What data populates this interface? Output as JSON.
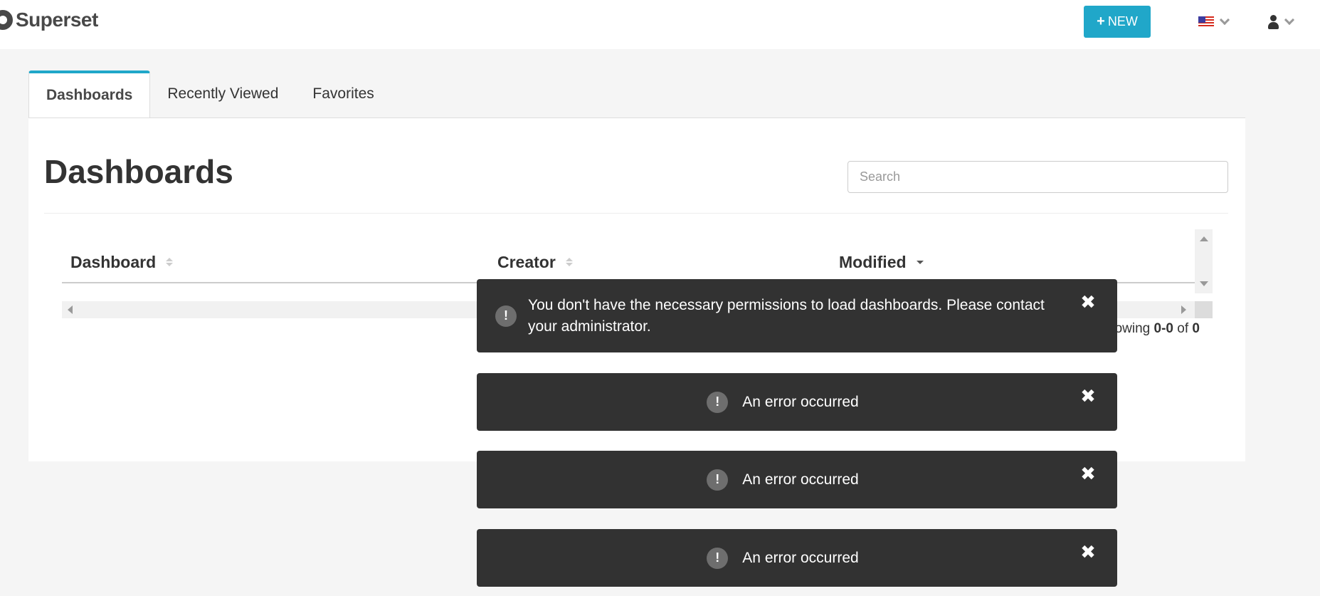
{
  "navbar": {
    "brand": "Superset",
    "new_button": "NEW",
    "new_icon": "+"
  },
  "tabs": [
    {
      "label": "Dashboards",
      "active": true
    },
    {
      "label": "Recently Viewed",
      "active": false
    },
    {
      "label": "Favorites",
      "active": false
    }
  ],
  "page": {
    "title": "Dashboards",
    "search_placeholder": "Search"
  },
  "table": {
    "columns": [
      "Dashboard",
      "Creator",
      "Modified"
    ],
    "rows": []
  },
  "pager": {
    "prefix": "Showing",
    "range": "0-0",
    "of": "of",
    "total": "0"
  },
  "toasts": [
    {
      "text": "You don't have the necessary permissions to load dashboards. Please contact your administrator.",
      "icon": "!",
      "close": "✖"
    },
    {
      "text": "An error occurred",
      "icon": "!",
      "close": "✖"
    },
    {
      "text": "An error occurred",
      "icon": "!",
      "close": "✖"
    },
    {
      "text": "An error occurred",
      "icon": "!",
      "close": "✖"
    }
  ],
  "colors": {
    "accent": "#20a7c9",
    "toast_bg": "#323232",
    "page_bg": "#f5f5f5"
  }
}
